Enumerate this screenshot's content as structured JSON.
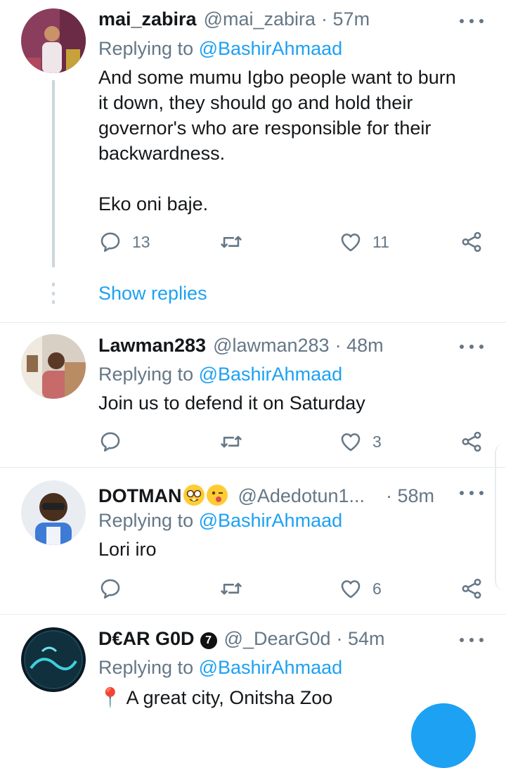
{
  "tweets": [
    {
      "name": "mai_zabira",
      "handle": "@mai_zabira",
      "time": "· 57m",
      "replying_label": "Replying to",
      "replying_to": "@BashirAhmaad",
      "text_lines": [
        "And some mumu Igbo people want to burn",
        "it down, they should go and hold their",
        "governor's who are responsible for their",
        "backwardness."
      ],
      "text_extra": "Eko oni baje.",
      "replies": "13",
      "retweets": "",
      "likes": "11",
      "show_replies": "Show replies"
    },
    {
      "name": "Lawman283",
      "handle": "@lawman283",
      "time": "· 48m",
      "replying_label": "Replying to",
      "replying_to": "@BashirAhmaad",
      "text": "Join us to defend it on Saturday",
      "replies": "",
      "retweets": "",
      "likes": "3"
    },
    {
      "name": "DOTMAN",
      "handle": "@Adedotun1...",
      "time": "· 58m",
      "replying_label": "Replying to",
      "replying_to": "@BashirAhmaad",
      "text": "Lori iro",
      "replies": "",
      "retweets": "",
      "likes": "6",
      "emojis": [
        "nerd-face",
        "winking-tongue-face"
      ]
    },
    {
      "name": "D€AR G0D",
      "handle": "@_DearG0d",
      "time": "· 54m",
      "replying_label": "Replying to",
      "replying_to": "@BashirAhmaad",
      "text": "📍 A great city, Onitsha Zoo",
      "badge": "7"
    }
  ],
  "colors": {
    "link": "#1da1f2",
    "secondary": "#657786",
    "divider": "#e6ecf0"
  }
}
